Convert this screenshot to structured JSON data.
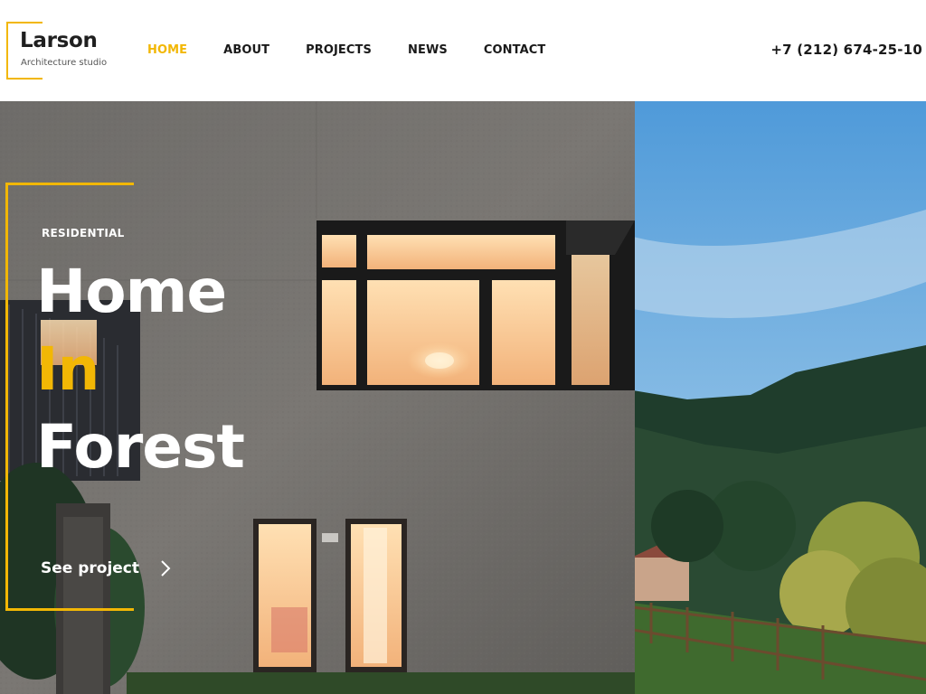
{
  "brand": {
    "name": "Larson",
    "tagline": "Architecture studio",
    "accent_color": "#f2b705"
  },
  "nav": {
    "items": [
      {
        "label": "HOME",
        "active": true
      },
      {
        "label": "ABOUT",
        "active": false
      },
      {
        "label": "PROJECTS",
        "active": false
      },
      {
        "label": "NEWS",
        "active": false
      },
      {
        "label": "CONTACT",
        "active": false
      }
    ]
  },
  "contact": {
    "phone": "+7 (212) 674-25-10"
  },
  "hero": {
    "category": "RESIDENTIAL",
    "title_lines": [
      "Home",
      "In",
      "Forest"
    ],
    "cta_label": "See project",
    "cta_icon": "chevron-right-icon"
  }
}
